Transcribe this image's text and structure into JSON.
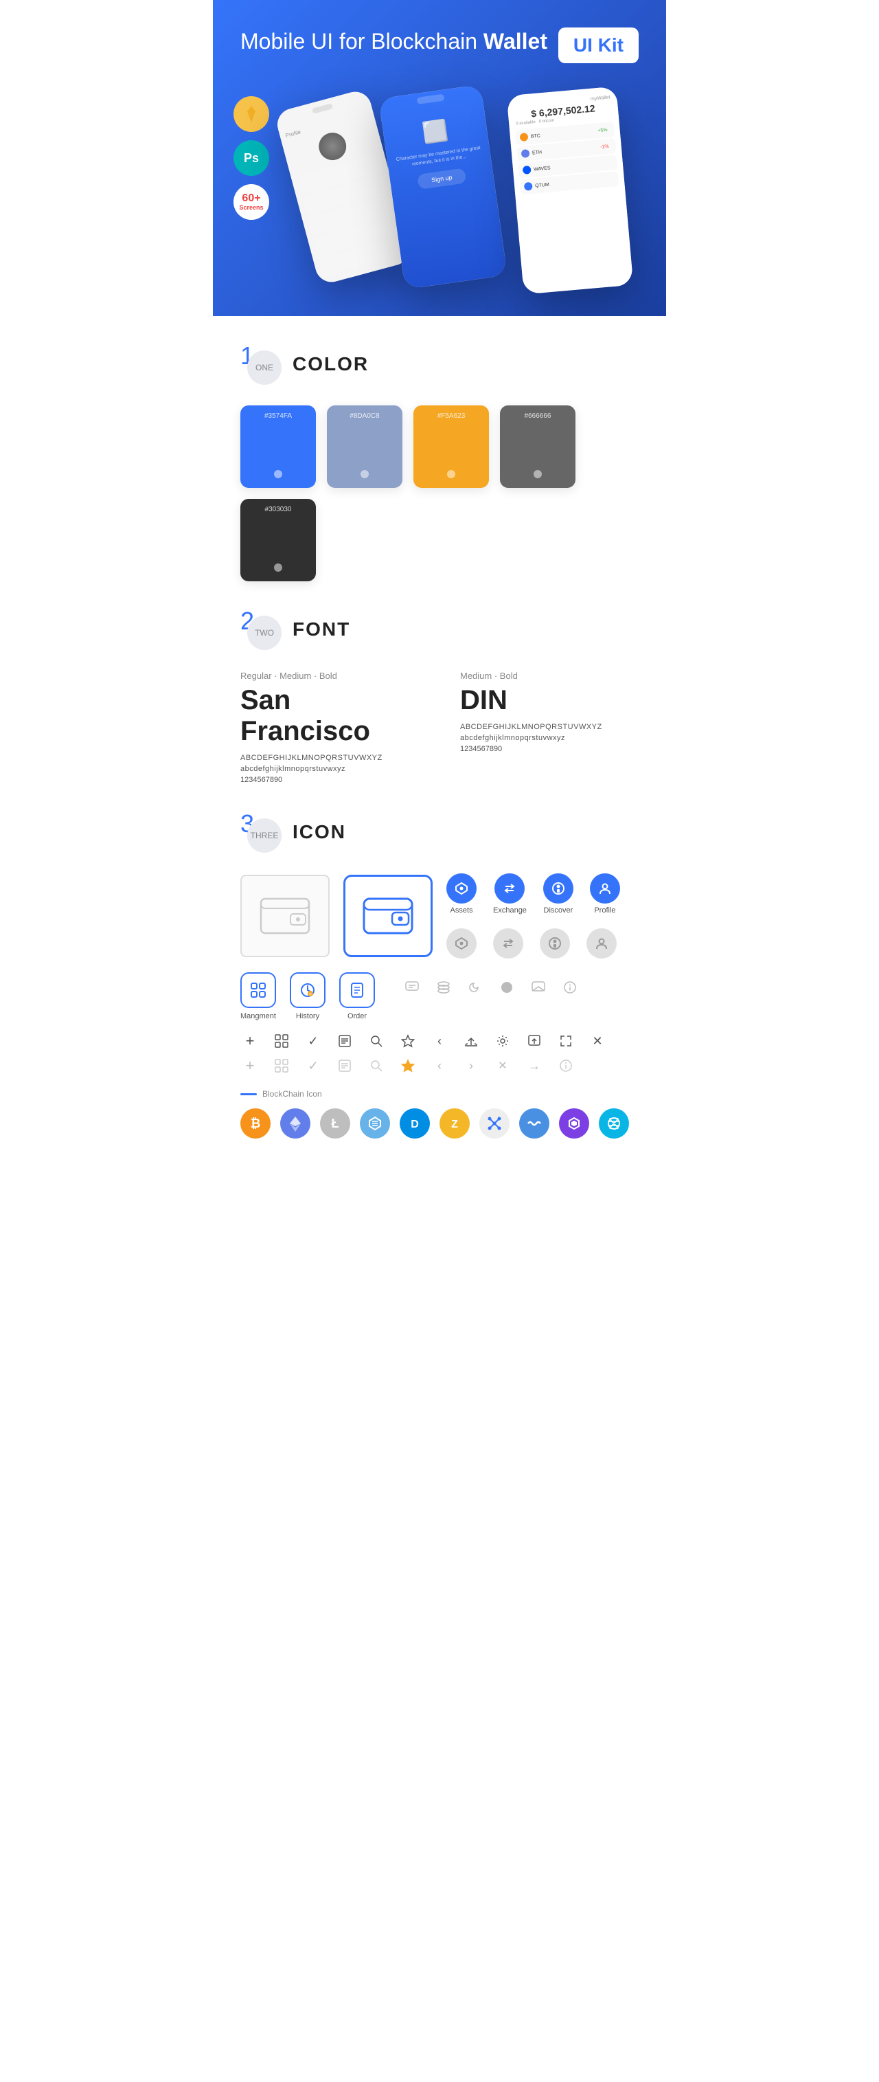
{
  "hero": {
    "title": "Mobile UI for Blockchain ",
    "title_bold": "Wallet",
    "badge": "UI Kit",
    "badges": {
      "sketch": "Sketch",
      "ps": "Ps",
      "screens": "60+\nScreens"
    }
  },
  "sections": {
    "color": {
      "number": "1",
      "number_word": "ONE",
      "title": "COLOR",
      "swatches": [
        {
          "hex": "#3574FA",
          "label": "#3574FA"
        },
        {
          "hex": "#8DA0C8",
          "label": "#8DA0C8"
        },
        {
          "hex": "#F5A623",
          "label": "#F5A623"
        },
        {
          "hex": "#666666",
          "label": "#666666"
        },
        {
          "hex": "#303030",
          "label": "#303030"
        }
      ]
    },
    "font": {
      "number": "2",
      "number_word": "TWO",
      "title": "FONT",
      "fonts": [
        {
          "style_label": "Regular · Medium · Bold",
          "name": "San Francisco",
          "uppercase": "ABCDEFGHIJKLMNOPQRSTUVWXYZ",
          "lowercase": "abcdefghijklmnopqrstuvwxyz",
          "numbers": "1234567890"
        },
        {
          "style_label": "Medium · Bold",
          "name": "DIN",
          "uppercase": "ABCDEFGHIJKLMNOPQRSTUVWXYZ",
          "lowercase": "abcdefghijklmnopqrstuvwxyz",
          "numbers": "1234567890"
        }
      ]
    },
    "icon": {
      "number": "3",
      "number_word": "THREE",
      "title": "ICON",
      "nav_icons_top": [
        {
          "label": "Assets",
          "color": "blue"
        },
        {
          "label": "Exchange",
          "color": "blue"
        },
        {
          "label": "Discover",
          "color": "blue"
        },
        {
          "label": "Profile",
          "color": "blue"
        }
      ],
      "nav_icons_bottom": [
        {
          "label": "",
          "color": "gray"
        },
        {
          "label": "",
          "color": "gray"
        },
        {
          "label": "",
          "color": "gray"
        },
        {
          "label": "",
          "color": "gray"
        }
      ],
      "app_icons": [
        {
          "label": "Mangment"
        },
        {
          "label": "History"
        },
        {
          "label": "Order"
        }
      ],
      "small_icons_row1": [
        "+",
        "⊞",
        "✓",
        "⊟",
        "⌕",
        "☆",
        "‹",
        "≪",
        "⚙",
        "⊡",
        "⇔",
        "×"
      ],
      "small_icons_row2": [
        "+",
        "⊞",
        "✓",
        "⊟",
        "⌕",
        "☆",
        "‹",
        "≪",
        "⊗",
        "⊡",
        "⇔",
        "ℹ"
      ],
      "misc_icons": [
        "▤",
        "≡",
        "◑",
        "●",
        "▣",
        "ℹ"
      ],
      "blockchain_label": "BlockChain Icon",
      "crypto_coins": [
        {
          "symbol": "₿",
          "name": "bitcoin",
          "bg": "#f7931a"
        },
        {
          "symbol": "Ξ",
          "name": "ethereum",
          "bg": "#627eea"
        },
        {
          "symbol": "Ł",
          "name": "litecoin",
          "bg": "#bebebe"
        },
        {
          "symbol": "N",
          "name": "nem",
          "bg": "#67b2e8"
        },
        {
          "symbol": "D",
          "name": "dash",
          "bg": "#008de4"
        },
        {
          "symbol": "Z",
          "name": "zcash",
          "bg": "#f4b728"
        },
        {
          "symbol": "◈",
          "name": "grid",
          "bg": "#3574FA"
        },
        {
          "symbol": "W",
          "name": "waves",
          "bg": "#0055ff"
        },
        {
          "symbol": "M",
          "name": "matic",
          "bg": "#7b3fe4"
        },
        {
          "symbol": "S",
          "name": "stellar",
          "bg": "#e84142"
        }
      ]
    }
  }
}
